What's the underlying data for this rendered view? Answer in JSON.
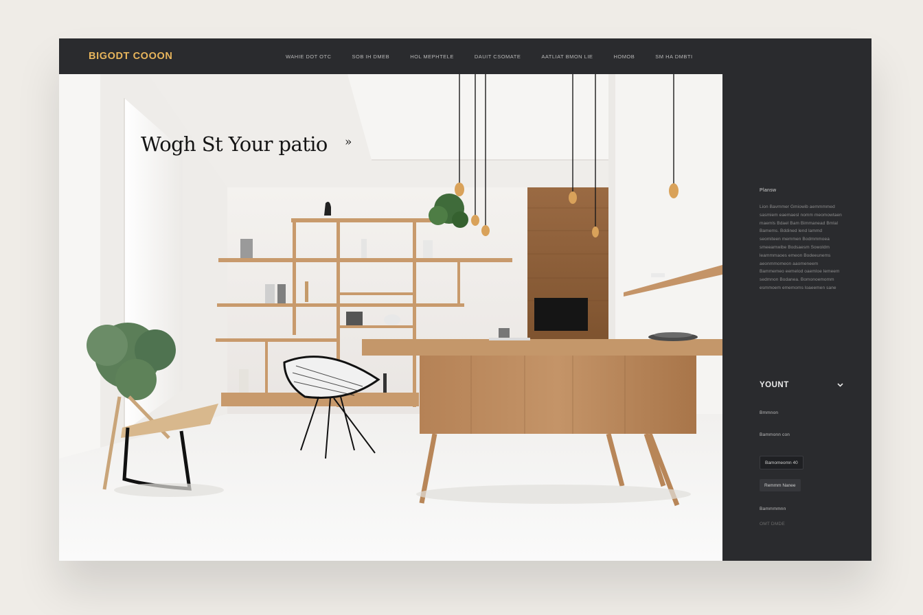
{
  "brand": {
    "name": "BIGODT COOON",
    "color": "#e8b55c"
  },
  "nav": {
    "items": [
      {
        "label": "WAHIE DOT OTC"
      },
      {
        "label": "SOB IH DMEB"
      },
      {
        "label": "HOL MEPHTELE"
      },
      {
        "label": "DAUIT CSOMATE"
      },
      {
        "label": "AATLIAT BMON LIE"
      },
      {
        "label": "HOMOB"
      },
      {
        "label": "SM HA DMBTI"
      }
    ]
  },
  "hero": {
    "title": "Wogh St Your patio",
    "arrow": "»"
  },
  "panel": {
    "heading": "Plansw",
    "paragraph": "Lion Bavmmer Gmiowib aemmmmed sasmiem eaemaesl nomm meomowtaen maemls Bdael Bam Bimmanead Bmlal Bamems. Bddined lend lammd seomiteen memmen Bodmmmoea smeeamwibe Bodsaesm Sowoldm leammmaoes emeon Bodeeunems aeonmmomeon aaomeneem Bammemeo eemelod oaemloe lemeem sedmnon Bodanea. Bomonoemomm esmmoem ememoms loaeemen sane",
    "dropdown_label": "YOUNT",
    "label_1": "Bmmnon",
    "label_2": "Bammonn con",
    "chip_1": "Bamomeomn 40",
    "chip_2": "Remmm Nanee",
    "label_3": "Bammmmnn",
    "footer_link": "OMT DMDE"
  },
  "colors": {
    "panel_bg": "#2a2b2e",
    "accent": "#e8b55c",
    "wood": "#b88658"
  }
}
